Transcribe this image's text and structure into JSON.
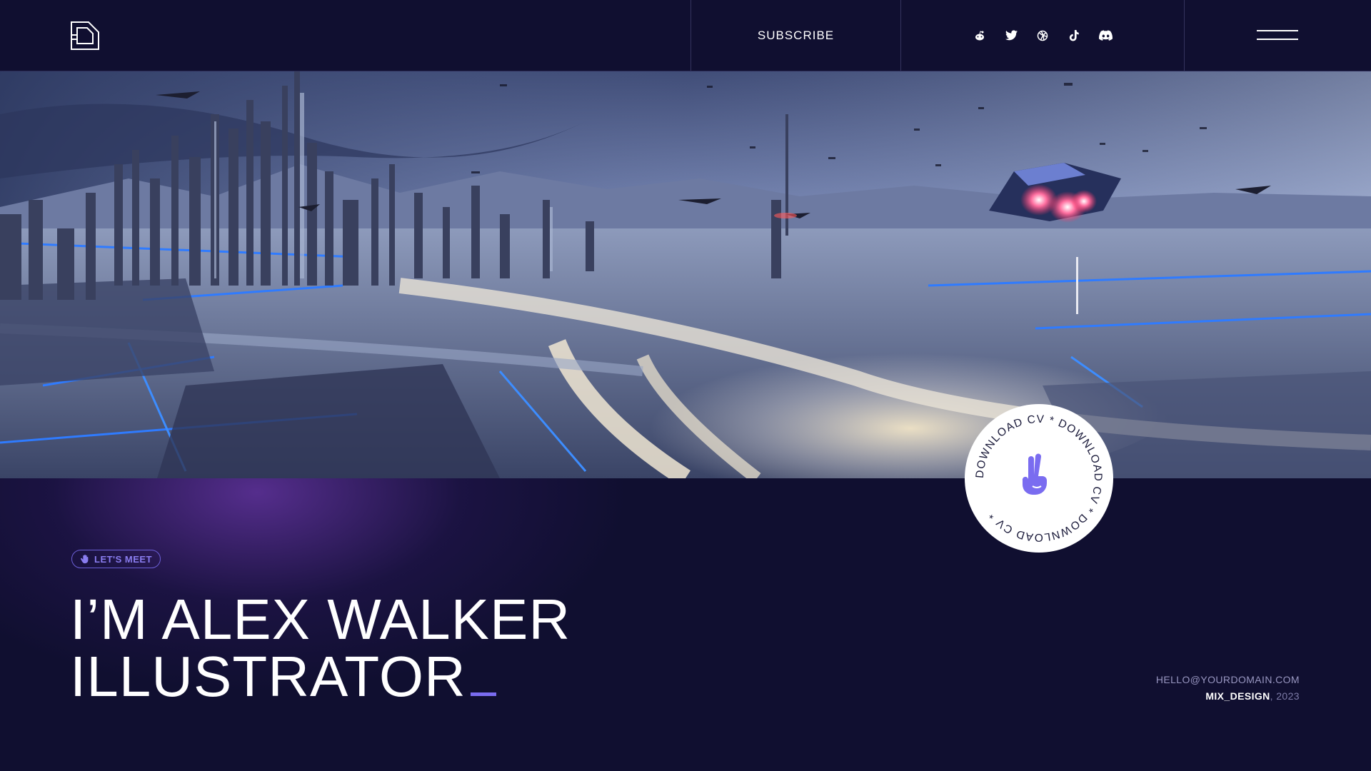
{
  "header": {
    "logo_icon": "square-d-logo-icon",
    "subscribe_label": "SUBSCRIBE",
    "socials": [
      "reddit-icon",
      "twitter-icon",
      "dribbble-icon",
      "tiktok-icon",
      "discord-icon"
    ],
    "menu_icon": "hamburger-menu-icon"
  },
  "hero": {
    "image": "futuristic-city-spaceship-illustration"
  },
  "badge": {
    "ring_text": "DOWNLOAD CV * DOWNLOAD CV * DOWNLOAD CV * ",
    "icon": "peace-hand-icon"
  },
  "intro": {
    "tag_label": "LET'S MEET",
    "tag_icon": "hand-icon",
    "headline_line1": "I’M ALEX WALKER",
    "headline_line2": "ILLUSTRATOR"
  },
  "contact": {
    "email": "HELLO@YOURDOMAIN.COM",
    "brand": "MIX_DESIGN",
    "year": ", 2023"
  },
  "colors": {
    "background": "#100f30",
    "accent": "#7a6cf0",
    "glow": "#7a3ebe"
  }
}
